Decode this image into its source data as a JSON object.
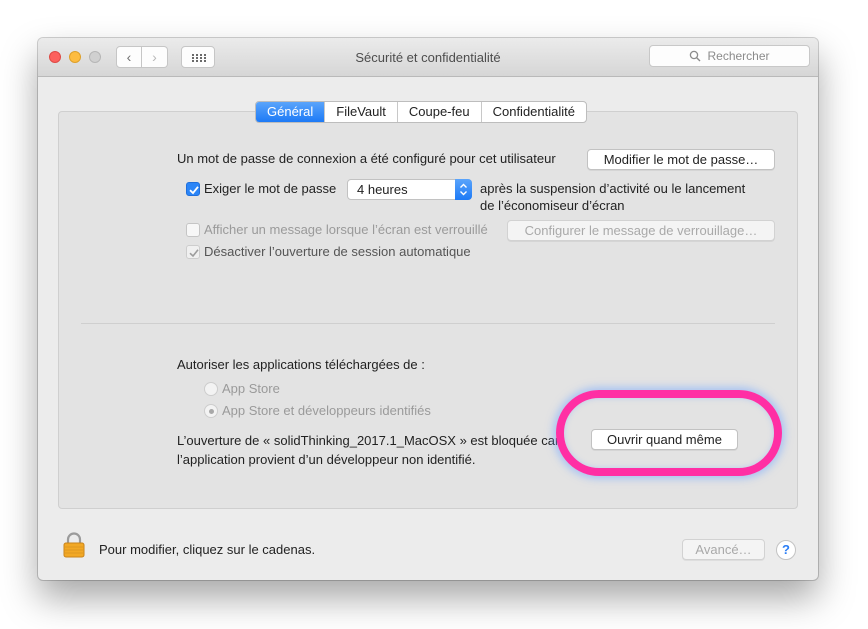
{
  "window": {
    "title": "Sécurité et confidentialité",
    "search_placeholder": "Rechercher"
  },
  "tabs": [
    {
      "label": "Général",
      "active": true
    },
    {
      "label": "FileVault",
      "active": false
    },
    {
      "label": "Coupe-feu",
      "active": false
    },
    {
      "label": "Confidentialité",
      "active": false
    }
  ],
  "general": {
    "password_set_text": "Un mot de passe de connexion a été configuré pour cet utilisateur",
    "change_password_button": "Modifier le mot de passe…",
    "require_password": {
      "label": "Exiger le mot de passe",
      "checked": true
    },
    "require_delay": {
      "selected": "4 heures"
    },
    "require_after_line1": "après la suspension d’activité ou le lancement",
    "require_after_line2": "de l’économiseur d’écran",
    "show_message": {
      "label": "Afficher un message lorsque l’écran est verrouillé",
      "checked": false,
      "enabled": false
    },
    "configure_message_button": "Configurer le message de verrouillage…",
    "disable_auto_login": {
      "label": "Désactiver l’ouverture de session automatique",
      "checked": true,
      "enabled": false
    }
  },
  "downloads": {
    "heading": "Autoriser les applications téléchargées de :",
    "options": [
      {
        "label": "App Store",
        "selected": false
      },
      {
        "label": "App Store et développeurs identifiés",
        "selected": true
      }
    ],
    "blocked_line1": "L’ouverture de « solidThinking_2017.1_MacOSX » est bloquée car",
    "blocked_line2": "l’application provient d’un développeur non identifié.",
    "open_anyway_button": "Ouvrir quand même"
  },
  "footer": {
    "lock_text": "Pour modifier, cliquez sur le cadenas.",
    "advanced_button": "Avancé…",
    "help_label": "?"
  },
  "colors": {
    "accent": "#1d7af6",
    "annotation": "#ff2fa4"
  }
}
